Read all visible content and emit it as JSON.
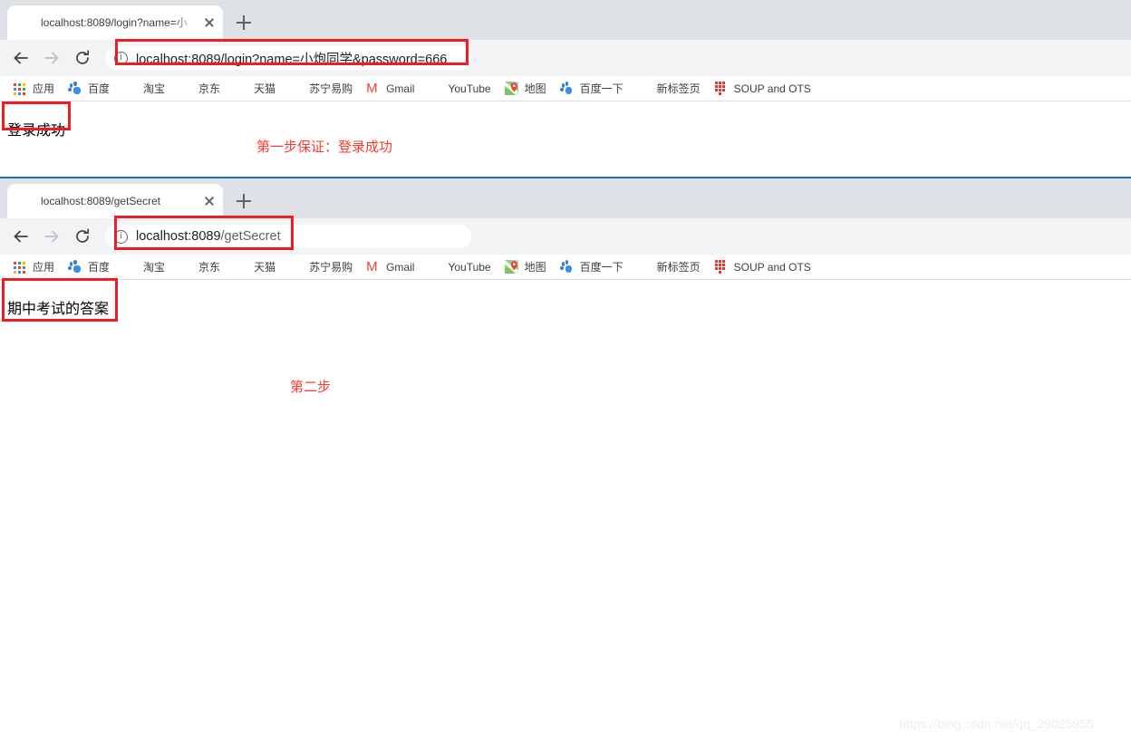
{
  "windows": [
    {
      "id": "window-login",
      "tab": {
        "title": "localhost:8089/login?name=小",
        "favicon": "globe-icon",
        "close_label": "×"
      },
      "newtab_label": "+",
      "toolbar": {
        "back": "back-arrow",
        "forward": "forward-arrow",
        "reload": "reload-arrow",
        "url_full": "localhost:8089/login?name=小炮同学&password=666",
        "url_host": "localhost:8089",
        "url_path": "/login?name=小炮同学&password=666"
      },
      "page": {
        "body_text": "登录成功",
        "annotation": "第一步保证：登录成功"
      }
    },
    {
      "id": "window-getsecret",
      "tab": {
        "title": "localhost:8089/getSecret",
        "favicon": "globe-icon",
        "close_label": "×"
      },
      "newtab_label": "+",
      "toolbar": {
        "back": "back-arrow",
        "forward": "forward-arrow",
        "reload": "reload-arrow",
        "url_full": "localhost:8089/getSecret",
        "url_host": "localhost:8089",
        "url_path": "/getSecret"
      },
      "page": {
        "body_text": "期中考试的答案",
        "annotation": "第二步"
      }
    }
  ],
  "bookmarks": [
    {
      "label": "应用",
      "icon": "apps-grid-icon"
    },
    {
      "label": "百度",
      "icon": "baidu-icon"
    },
    {
      "label": "淘宝",
      "icon": "globe-icon"
    },
    {
      "label": "京东",
      "icon": "globe-icon"
    },
    {
      "label": "天猫",
      "icon": "globe-icon"
    },
    {
      "label": "苏宁易购",
      "icon": "globe-icon"
    },
    {
      "label": "Gmail",
      "icon": "gmail-icon"
    },
    {
      "label": "YouTube",
      "icon": "youtube-icon"
    },
    {
      "label": "地图",
      "icon": "google-maps-icon"
    },
    {
      "label": "百度一下",
      "icon": "baidu-icon"
    },
    {
      "label": "新标签页",
      "icon": "globe-icon"
    },
    {
      "label": "SOUP and OTS",
      "icon": "soup-ots-icon"
    }
  ],
  "watermark": "https://blog.csdn.net/qq_29025955",
  "colors": {
    "annotation_red": "#fe3b30",
    "box_red": "#ef1c23",
    "tabstrip_bg": "#dee1e6",
    "toolbar_bg": "#f1f3f4",
    "divider_blue": "#1a73c8"
  }
}
